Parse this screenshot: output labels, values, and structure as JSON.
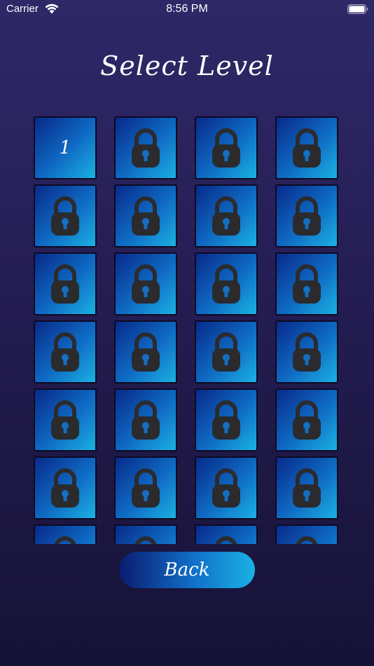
{
  "status_bar": {
    "carrier": "Carrier",
    "time": "8:56 PM",
    "wifi_icon": "wifi-icon",
    "battery_icon": "battery-icon"
  },
  "title": "Select Level",
  "levels": [
    {
      "label": "1",
      "locked": false
    },
    {
      "label": "",
      "locked": true
    },
    {
      "label": "",
      "locked": true
    },
    {
      "label": "",
      "locked": true
    },
    {
      "label": "",
      "locked": true
    },
    {
      "label": "",
      "locked": true
    },
    {
      "label": "",
      "locked": true
    },
    {
      "label": "",
      "locked": true
    },
    {
      "label": "",
      "locked": true
    },
    {
      "label": "",
      "locked": true
    },
    {
      "label": "",
      "locked": true
    },
    {
      "label": "",
      "locked": true
    },
    {
      "label": "",
      "locked": true
    },
    {
      "label": "",
      "locked": true
    },
    {
      "label": "",
      "locked": true
    },
    {
      "label": "",
      "locked": true
    },
    {
      "label": "",
      "locked": true
    },
    {
      "label": "",
      "locked": true
    },
    {
      "label": "",
      "locked": true
    },
    {
      "label": "",
      "locked": true
    },
    {
      "label": "",
      "locked": true
    },
    {
      "label": "",
      "locked": true
    },
    {
      "label": "",
      "locked": true
    },
    {
      "label": "",
      "locked": true
    },
    {
      "label": "",
      "locked": true
    },
    {
      "label": "",
      "locked": true
    },
    {
      "label": "",
      "locked": true
    },
    {
      "label": "",
      "locked": true
    }
  ],
  "lock_icon": "lock-icon",
  "back_button": {
    "label": "Back"
  },
  "colors": {
    "background_top": "#2f2868",
    "background_bottom": "#161236",
    "tile_dark": "#082a8a",
    "tile_light": "#1ab2e3",
    "lock": "#2b2b2e"
  }
}
